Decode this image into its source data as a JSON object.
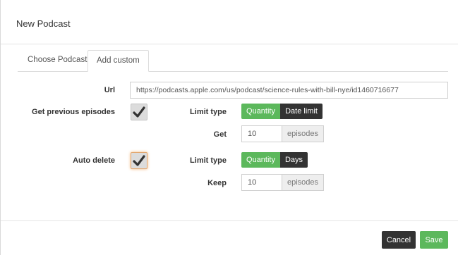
{
  "modal": {
    "title": "New Podcast"
  },
  "tabs": [
    {
      "label": "Choose Podcast",
      "active": false
    },
    {
      "label": "Add custom",
      "active": true
    }
  ],
  "form": {
    "url_label": "Url",
    "url_value": "https://podcasts.apple.com/us/podcast/science-rules-with-bill-nye/id1460716677",
    "get_previous": {
      "label": "Get previous episodes",
      "checked": true,
      "limit_type_label": "Limit type",
      "options": [
        "Quantity",
        "Date limit"
      ],
      "selected": "Quantity",
      "get_label": "Get",
      "get_value": "10",
      "unit": "episodes"
    },
    "auto_delete": {
      "label": "Auto delete",
      "checked": true,
      "limit_type_label": "Limit type",
      "options": [
        "Quantity",
        "Days"
      ],
      "selected": "Quantity",
      "keep_label": "Keep",
      "keep_value": "10",
      "unit": "episodes"
    }
  },
  "footer": {
    "cancel_label": "Cancel",
    "save_label": "Save"
  },
  "colors": {
    "accent": "#5cb85c",
    "dark": "#333333",
    "focus": "#f0b77c"
  },
  "icons": {
    "checkbox": "checkmark-icon"
  }
}
